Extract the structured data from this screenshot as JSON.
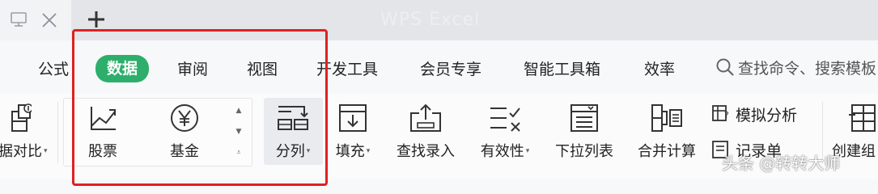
{
  "titlebar": {
    "new_tab_label": "+",
    "faint_text": "WPS Excel"
  },
  "menu": {
    "tabs": [
      {
        "label": "公式"
      },
      {
        "label": "数据",
        "active": true
      },
      {
        "label": "审阅"
      },
      {
        "label": "视图"
      },
      {
        "label": "开发工具"
      },
      {
        "label": "会员专享"
      },
      {
        "label": "智能工具箱"
      },
      {
        "label": "效率"
      }
    ],
    "search_placeholder": "查找命令、搜索模板"
  },
  "ribbon": {
    "compare_label": "据对比",
    "stocks_label": "股票",
    "fund_label": "基金",
    "split_label": "分列",
    "fill_label": "填充",
    "lookup_label": "查找录入",
    "validity_label": "有效性",
    "dropdown_label": "下拉列表",
    "merge_calc_label": "合并计算",
    "simulate_label": "模拟分析",
    "record_label": "记录单",
    "group_label": "创建组",
    "caret": "▾",
    "scroll_up": "▲",
    "scroll_down": "▼",
    "scroll_more": "⩡"
  },
  "watermark": "头条 @转转大师",
  "colors": {
    "active_tab": "#2dae6b",
    "highlight_box": "#e02020"
  }
}
